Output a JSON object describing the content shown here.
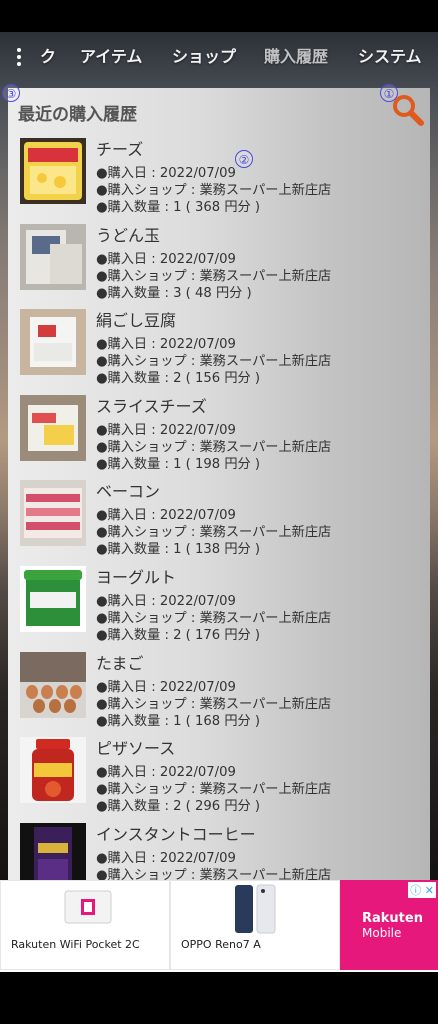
{
  "nav": {
    "tabs": [
      {
        "label": "ク",
        "active": false
      },
      {
        "label": "アイテム",
        "active": false
      },
      {
        "label": "ショップ",
        "active": false
      },
      {
        "label": "購入履歴",
        "active": true
      },
      {
        "label": "システム",
        "active": false
      }
    ]
  },
  "panel": {
    "title": "最近の購入履歴",
    "markers": [
      "①",
      "②",
      "③"
    ]
  },
  "colors": {
    "search_icon": "#e05a1e",
    "ad_brand": "#e6187b",
    "marker": "#4a4adf"
  },
  "purchases": [
    {
      "name": "チーズ",
      "date": "●購入日 : 2022/07/09",
      "shop": "●購入ショップ : 業務スーパー上新庄店",
      "qty": "●購入数量 : 1 ( 368 円分 )"
    },
    {
      "name": "うどん玉",
      "date": "●購入日 : 2022/07/09",
      "shop": "●購入ショップ : 業務スーパー上新庄店",
      "qty": "●購入数量 : 3 ( 48 円分 )"
    },
    {
      "name": "絹ごし豆腐",
      "date": "●購入日 : 2022/07/09",
      "shop": "●購入ショップ : 業務スーパー上新庄店",
      "qty": "●購入数量 : 2 ( 156 円分 )"
    },
    {
      "name": "スライスチーズ",
      "date": "●購入日 : 2022/07/09",
      "shop": "●購入ショップ : 業務スーパー上新庄店",
      "qty": "●購入数量 : 1 ( 198 円分 )"
    },
    {
      "name": "ベーコン",
      "date": "●購入日 : 2022/07/09",
      "shop": "●購入ショップ : 業務スーパー上新庄店",
      "qty": "●購入数量 : 1 ( 138 円分 )"
    },
    {
      "name": "ヨーグルト",
      "date": "●購入日 : 2022/07/09",
      "shop": "●購入ショップ : 業務スーパー上新庄店",
      "qty": "●購入数量 : 2 ( 176 円分 )"
    },
    {
      "name": "たまご",
      "date": "●購入日 : 2022/07/09",
      "shop": "●購入ショップ : 業務スーパー上新庄店",
      "qty": "●購入数量 : 1 ( 168 円分 )"
    },
    {
      "name": "ピザソース",
      "date": "●購入日 : 2022/07/09",
      "shop": "●購入ショップ : 業務スーパー上新庄店",
      "qty": "●購入数量 : 2 ( 296 円分 )"
    },
    {
      "name": "インスタントコーヒー",
      "date": "●購入日 : 2022/07/09",
      "shop": "●購入ショップ : 業務スーパー上新庄店",
      "qty": ""
    }
  ],
  "ad": {
    "items": [
      {
        "label": "Rakuten WiFi Pocket 2C"
      },
      {
        "label": "OPPO Reno7 A"
      }
    ],
    "brand_name": "Rakuten",
    "brand_sub": "Mobile",
    "choices": "ⓘ ✕"
  }
}
